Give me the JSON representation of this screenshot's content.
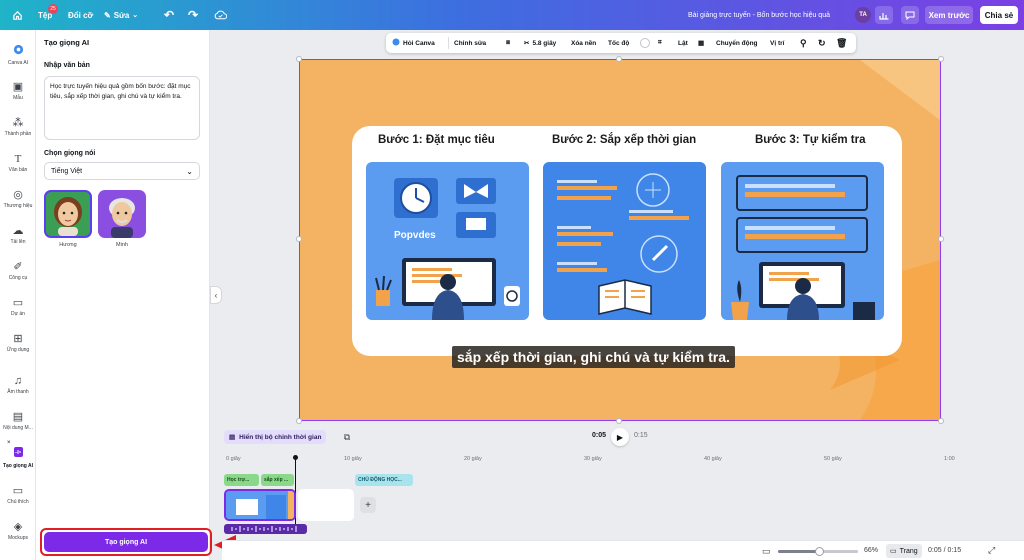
{
  "topbar": {
    "file": "Tệp",
    "file_badge": "25",
    "resize": "Đổi cỡ",
    "edit": "Sửa",
    "doc_title": "Bài giảng trực tuyến - Bốn bước học hiệu quả",
    "avatar": "TA",
    "preview": "Xem trước",
    "share": "Chia sẻ"
  },
  "rail": [
    {
      "label": "Canva AI",
      "icon": "canva-ai-icon"
    },
    {
      "label": "Mẫu",
      "icon": "template-icon"
    },
    {
      "label": "Thành phần",
      "icon": "elements-icon"
    },
    {
      "label": "Văn bản",
      "icon": "text-icon"
    },
    {
      "label": "Thương hiệu",
      "icon": "brand-icon"
    },
    {
      "label": "Tải lên",
      "icon": "upload-icon"
    },
    {
      "label": "Công cụ",
      "icon": "tools-icon"
    },
    {
      "label": "Dự án",
      "icon": "folder-icon"
    },
    {
      "label": "Ứng dụng",
      "icon": "apps-icon"
    },
    {
      "label": "Âm thanh",
      "icon": "music-icon"
    },
    {
      "label": "Nội dung M...",
      "icon": "media-icon"
    },
    {
      "label": "Tạo giọng AI",
      "icon": "ai-voice-icon"
    },
    {
      "label": "Chú thích",
      "icon": "caption-icon"
    },
    {
      "label": "Mockups",
      "icon": "mockup-icon"
    }
  ],
  "panel": {
    "title": "Tạo giọng AI",
    "input_label": "Nhập văn bản",
    "input_text": "Học trực tuyến hiệu quả gồm bốn bước: đặt mục tiêu, sắp xếp thời gian, ghi chú và tự kiểm tra.",
    "voice_label": "Chọn giọng nói",
    "language": "Tiếng Việt",
    "voices": [
      {
        "name": "Hương"
      },
      {
        "name": "Minh"
      }
    ],
    "generate_button": "Tạo giọng AI"
  },
  "context_toolbar": {
    "ask": "Hỏi Canva",
    "edit": "Chỉnh sửa",
    "duration": "5.8 giây",
    "bg_remove": "Xóa nền",
    "speed": "Tốc độ",
    "flip": "Lật",
    "animate": "Chuyển động",
    "position": "Vị trí"
  },
  "slide": {
    "steps": [
      {
        "title": "Bước 1: Đặt mục tiêu"
      },
      {
        "title": "Bước 2: Sắp xếp thời gian"
      },
      {
        "title": "Bước 3: Tự kiểm tra"
      }
    ],
    "illus_brand": "Popvdes",
    "subtitle": "sắp xếp thời gian, ghi chú và tự kiểm tra."
  },
  "timeline": {
    "show_timeline": "Hiển thị bộ chỉnh thời gian",
    "current": "0:05",
    "total": "0:15",
    "ticks": [
      "0 giây",
      "10 giây",
      "20 giây",
      "30 giây",
      "40 giây",
      "50 giây",
      "1:00"
    ],
    "captions": [
      "Học trự...",
      "sắp xếp ...",
      "CHỦ ĐỘNG HỌC..."
    ]
  },
  "bottombar": {
    "zoom": "66%",
    "pages": "Trang",
    "time": "0:05 / 0:15"
  }
}
